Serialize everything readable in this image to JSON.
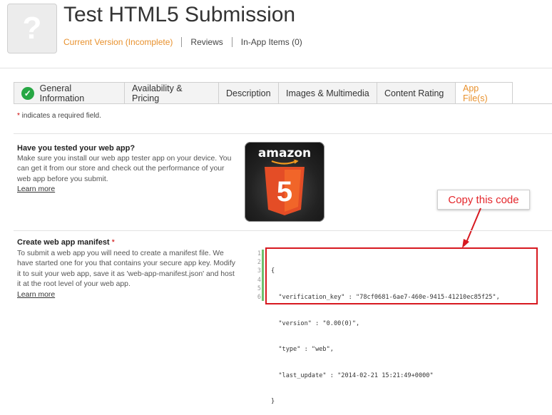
{
  "app": {
    "icon_placeholder": "?",
    "title": "Test HTML5 Submission"
  },
  "subnav": [
    {
      "label": "Current Version (Incomplete)",
      "current": true
    },
    {
      "label": "Reviews",
      "current": false
    },
    {
      "label": "In-App Items (0)",
      "current": false
    }
  ],
  "tabs": [
    {
      "label": "General Information",
      "complete": true,
      "active": false
    },
    {
      "label": "Availability & Pricing",
      "complete": false,
      "active": false
    },
    {
      "label": "Description",
      "complete": false,
      "active": false
    },
    {
      "label": "Images & Multimedia",
      "complete": false,
      "active": false
    },
    {
      "label": "Content Rating",
      "complete": false,
      "active": false
    },
    {
      "label": "App File(s)",
      "complete": false,
      "active": true
    }
  ],
  "required_note": {
    "star": "*",
    "text": " indicates a required field."
  },
  "section_tested": {
    "title": "Have you tested your web app?",
    "body": "Make sure you install our web app tester app on your device. You can get it from our store and check out the performance of your web app before you submit.",
    "link": "Learn more"
  },
  "amazon_icon": {
    "brand": "amazon",
    "badge_number": "5"
  },
  "section_manifest": {
    "title": "Create web app manifest",
    "star": "*",
    "body": "To submit a web app you will need to create a manifest file. We have started one for you that contains your secure app key. Modify it to suit your web app, save it as 'web-app-manifest.json' and host it at the root level of your web app.",
    "link": "Learn more"
  },
  "callout": {
    "text": "Copy this code"
  },
  "code_editor": {
    "line_numbers": [
      "1",
      "2",
      "3",
      "4",
      "5",
      "6"
    ],
    "lines": [
      "{",
      "  \"verification_key\" : \"78cf0681-6ae7-460e-9415-41210ec85f25\",",
      "  \"version\" : \"0.00(0)\",",
      "  \"type\" : \"web\",",
      "  \"last_update\" : \"2014-02-21 15:21:49+0000\"",
      "}"
    ]
  },
  "colors": {
    "accent_orange": "#e8912d",
    "highlight_red": "#d71920",
    "check_green": "#27a744"
  }
}
